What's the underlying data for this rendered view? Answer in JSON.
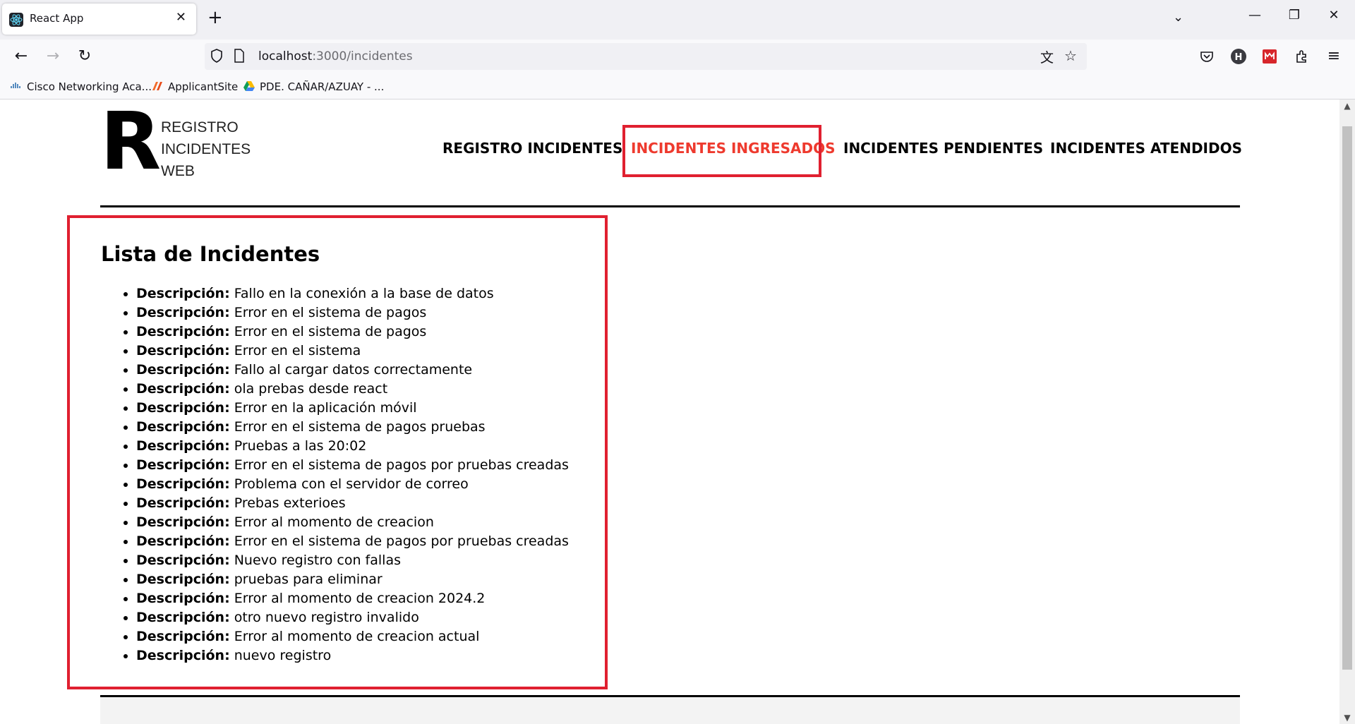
{
  "browser": {
    "tab_title": "React App",
    "url_host": "localhost",
    "url_rest": ":3000/incidentes",
    "bookmarks": [
      "Cisco Networking Aca...",
      "ApplicantSite",
      "PDE. CAÑAR/AZUAY - ..."
    ]
  },
  "logo": {
    "letter": "R",
    "line1": "REGISTRO",
    "line2": "INCIDENTES",
    "line3": "WEB"
  },
  "nav": {
    "items": [
      {
        "label": "REGISTRO INCIDENTES"
      },
      {
        "label": "INCIDENTES INGRESADOS",
        "active": true
      },
      {
        "label": "INCIDENTES PENDIENTES"
      },
      {
        "label": "INCIDENTES ATENDIDOS"
      }
    ]
  },
  "main": {
    "title": "Lista de Incidentes",
    "field_label": "Descripción:",
    "incidents": [
      "Fallo en la conexión a la base de datos",
      "Error en el sistema de pagos",
      "Error en el sistema de pagos",
      "Error en el sistema",
      "Fallo al cargar datos correctamente",
      "ola prebas desde react",
      "Error en la aplicación móvil",
      "Error en el sistema de pagos pruebas",
      "Pruebas a las 20:02",
      "Error en el sistema de pagos por pruebas creadas",
      "Problema con el servidor de correo",
      "Prebas exterioes",
      "Error al momento de creacion",
      "Error en el sistema de pagos por pruebas creadas",
      "Nuevo registro con fallas",
      "pruebas para eliminar",
      "Error al momento de creacion 2024.2",
      "otro nuevo registro invalido",
      "Error al momento de creacion actual",
      "nuevo registro"
    ]
  },
  "colors": {
    "accent": "#ee3a2e",
    "highlight_box": "#e02030"
  }
}
